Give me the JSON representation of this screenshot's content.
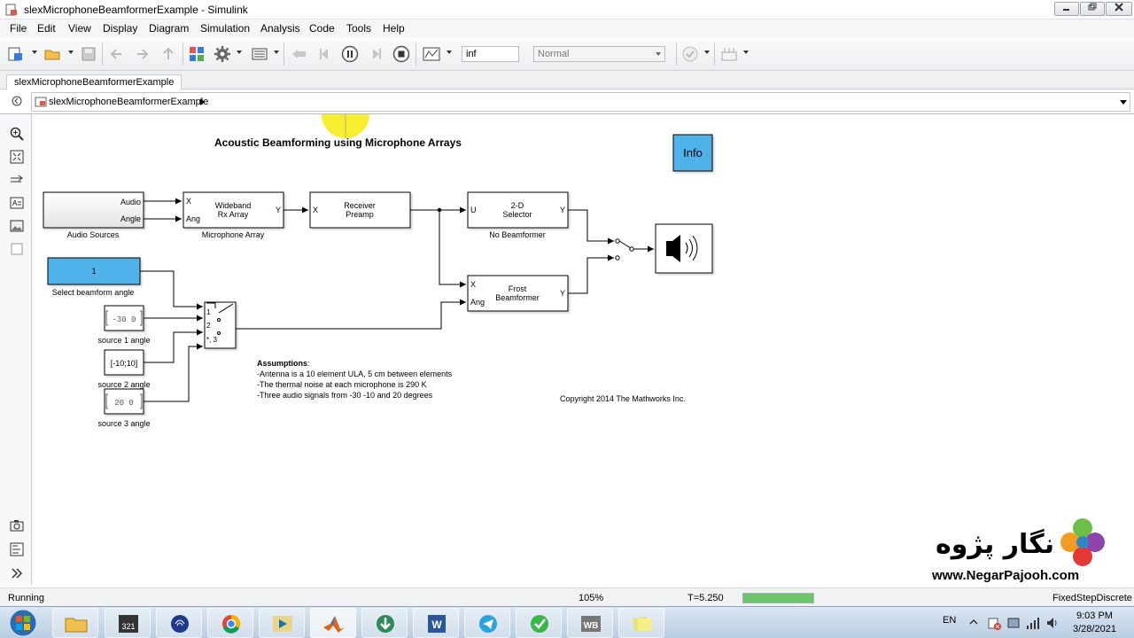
{
  "window": {
    "title": "slexMicrophoneBeamformerExample - Simulink"
  },
  "menu": [
    "File",
    "Edit",
    "View",
    "Display",
    "Diagram",
    "Simulation",
    "Analysis",
    "Code",
    "Tools",
    "Help"
  ],
  "toolbar": {
    "stop_time": "inf",
    "sim_mode": "Normal"
  },
  "tab": {
    "label": "slexMicrophoneBeamformerExample"
  },
  "breadcrumb": {
    "label": "slexMicrophoneBeamformerExample"
  },
  "diagram": {
    "title": "Acoustic Beamforming using Microphone Arrays",
    "info_label": "Info",
    "audio_sources": {
      "name": "Audio Sources",
      "port_audio": "Audio",
      "port_angle": "Angle"
    },
    "mic_array": {
      "name": "Microphone Array",
      "line1": "Wideband",
      "line2": "Rx Array",
      "port_x": "X",
      "port_ang": "Ang",
      "port_y": "Y"
    },
    "receiver": {
      "line1": "Receiver",
      "line2": "Preamp",
      "port_x": "X"
    },
    "selector": {
      "name": "No Beamformer",
      "line1": "2-D",
      "line2": "Selector",
      "port_u": "U",
      "port_y": "Y"
    },
    "frost": {
      "line1": "Frost",
      "line2": "Beamformer",
      "port_x": "X",
      "port_ang": "Ang",
      "port_y": "Y"
    },
    "select_angle": {
      "value": "1",
      "name": "Select beamform angle"
    },
    "source1": {
      "value": "-30  0",
      "name": "source 1 angle"
    },
    "source2": {
      "value": "[-10;10]",
      "name": "source 2 angle"
    },
    "source3": {
      "value": "20  0",
      "name": "source 3 angle"
    },
    "switch_ports": [
      "1",
      "2",
      "*, 3"
    ],
    "assumptions": {
      "heading": "Assumptions",
      "lines": [
        "-Antenna is a 10 element ULA, 5 cm between elements",
        "-The thermal noise at each microphone is 290 K",
        "-Three audio signals from -30 -10 and 20 degrees"
      ]
    },
    "copyright": "Copyright 2014 The Mathworks Inc."
  },
  "status": {
    "state": "Running",
    "zoom": "105%",
    "time": "T=5.250",
    "progress": 1.0,
    "solver": "FixedStepDiscrete"
  },
  "watermark": {
    "text": "نگار پژوه",
    "url": "www.NegarPajooh.com"
  },
  "taskbar": {
    "lang": "EN",
    "time": "9:03 PM",
    "date": "3/28/2021",
    "apps": [
      "explorer",
      "media-player-classic",
      "fingerprint-app",
      "chrome",
      "video-player",
      "matlab",
      "internet-download-manager",
      "word",
      "telegram",
      "vpn-app",
      "workbench",
      "sticky-notes"
    ]
  },
  "colors": {
    "accent_block": "#4fb3ea",
    "highlight": "#f7ec1a",
    "progress": "#6cc56c"
  }
}
